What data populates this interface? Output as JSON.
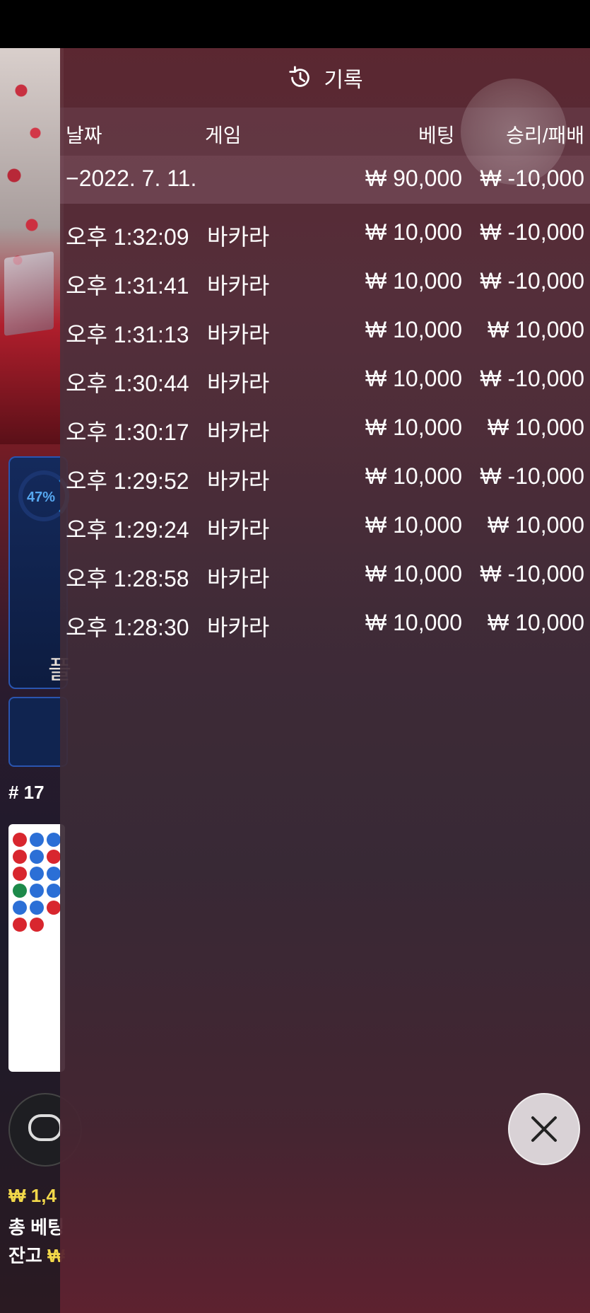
{
  "background": {
    "timer_percent": "47%",
    "player_label": "플",
    "round_number": "# 17",
    "balance": "₩ 1,4",
    "total_bet": "총 베팅",
    "remaining_label": "잔고",
    "remaining_currency": "₩"
  },
  "panel": {
    "title": "기록",
    "icon": "history-icon",
    "columns": {
      "date": "날짜",
      "game": "게임",
      "bet": "베팅",
      "win_loss": "승리/패배"
    },
    "date_row": {
      "date": "−2022. 7. 11.",
      "bet": "₩ 90,000",
      "win_loss": "₩ -10,000"
    },
    "rows": [
      {
        "time": "오후 1:32:09",
        "game": "바카라",
        "bet": "₩ 10,000",
        "win_loss": "₩ -10,000"
      },
      {
        "time": "오후 1:31:41",
        "game": "바카라",
        "bet": "₩ 10,000",
        "win_loss": "₩ -10,000"
      },
      {
        "time": "오후 1:31:13",
        "game": "바카라",
        "bet": "₩ 10,000",
        "win_loss": "₩ 10,000"
      },
      {
        "time": "오후 1:30:44",
        "game": "바카라",
        "bet": "₩ 10,000",
        "win_loss": "₩ -10,000"
      },
      {
        "time": "오후 1:30:17",
        "game": "바카라",
        "bet": "₩ 10,000",
        "win_loss": "₩ 10,000"
      },
      {
        "time": "오후 1:29:52",
        "game": "바카라",
        "bet": "₩ 10,000",
        "win_loss": "₩ -10,000"
      },
      {
        "time": "오후 1:29:24",
        "game": "바카라",
        "bet": "₩ 10,000",
        "win_loss": "₩ 10,000"
      },
      {
        "time": "오후 1:28:58",
        "game": "바카라",
        "bet": "₩ 10,000",
        "win_loss": "₩ -10,000"
      },
      {
        "time": "오후 1:28:30",
        "game": "바카라",
        "bet": "₩ 10,000",
        "win_loss": "₩ 10,000"
      }
    ],
    "close_icon": "close-icon"
  },
  "colors": {
    "panel_bg": "#5a2a36",
    "text": "#ffffff",
    "accent_yellow": "#f2d84a",
    "blue": "#2a55b0"
  }
}
